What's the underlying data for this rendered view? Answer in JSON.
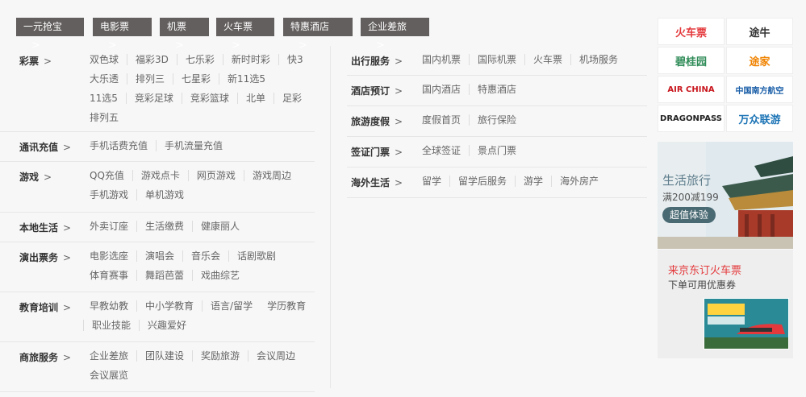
{
  "tabs": [
    {
      "label": "一元抢宝",
      "name": "tab-yiyuan"
    },
    {
      "label": "电影票",
      "name": "tab-movie-tickets"
    },
    {
      "label": "机票",
      "name": "tab-air-tickets"
    },
    {
      "label": "火车票",
      "name": "tab-train-tickets"
    },
    {
      "label": "特惠酒店",
      "name": "tab-discount-hotels"
    },
    {
      "label": "企业差旅",
      "name": "tab-business-travel"
    }
  ],
  "chevron": ">",
  "left_categories": [
    {
      "label": "彩票",
      "links": [
        "双色球",
        "福彩3D",
        "七乐彩",
        "新时时彩",
        "快3",
        "大乐透",
        "排列三",
        "七星彩",
        "新11选5",
        "11选5",
        "竞彩足球",
        "竞彩篮球",
        "北单",
        "足彩",
        "排列五"
      ]
    },
    {
      "label": "通讯充值",
      "links": [
        "手机话费充值",
        "手机流量充值"
      ]
    },
    {
      "label": "游戏",
      "links": [
        "QQ充值",
        "游戏点卡",
        "网页游戏",
        "游戏周边",
        "手机游戏",
        "单机游戏"
      ]
    },
    {
      "label": "本地生活",
      "links": [
        "外卖订座",
        "生活缴费",
        "健康丽人"
      ]
    },
    {
      "label": "演出票务",
      "links": [
        "电影选座",
        "演唱会",
        "音乐会",
        "话剧歌剧",
        "体育赛事",
        "舞蹈芭蕾",
        "戏曲综艺"
      ]
    },
    {
      "label": "教育培训",
      "links": [
        "早教幼教",
        "中小学教育",
        "语言/留学",
        "学历教育",
        "职业技能",
        "兴趣爱好"
      ]
    },
    {
      "label": "商旅服务",
      "links": [
        "企业差旅",
        "团队建设",
        "奖励旅游",
        "会议周边",
        "会议展览"
      ]
    }
  ],
  "right_categories": [
    {
      "label": "出行服务",
      "links": [
        "国内机票",
        "国际机票",
        "火车票",
        "机场服务"
      ]
    },
    {
      "label": "酒店预订",
      "links": [
        "国内酒店",
        "特惠酒店"
      ]
    },
    {
      "label": "旅游度假",
      "links": [
        "度假首页",
        "旅行保险"
      ]
    },
    {
      "label": "签证门票",
      "links": [
        "全球签证",
        "景点门票"
      ]
    },
    {
      "label": "海外生活",
      "links": [
        "留学",
        "留学后服务",
        "游学",
        "海外房产"
      ]
    }
  ],
  "logos": [
    {
      "text": "火车票",
      "color": "#e4393c"
    },
    {
      "text": "途牛",
      "color": "#333333"
    },
    {
      "text": "碧桂园",
      "color": "#2e8b57"
    },
    {
      "text": "途家",
      "color": "#f08300"
    },
    {
      "text": "AIR CHINA",
      "color": "#c8161d"
    },
    {
      "text": "中国南方航空",
      "color": "#1b5fa8"
    },
    {
      "text": "DRAGONPASS",
      "color": "#222222"
    },
    {
      "text": "万众联游",
      "color": "#1a73b5"
    }
  ],
  "promo1": {
    "title": "生活旅行",
    "subtitle": "满200减199",
    "button": "超值体验"
  },
  "promo2": {
    "title": "来京东订火车票",
    "subtitle": "下单可用优惠券"
  }
}
